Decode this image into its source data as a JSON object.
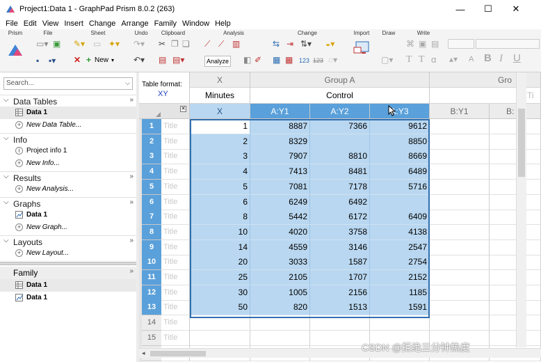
{
  "window": {
    "title": "Project1:Data 1 - GraphPad Prism 8.0.2 (263)",
    "minimize": "—",
    "maximize": "☐",
    "close": "✕"
  },
  "menu": [
    "File",
    "Edit",
    "View",
    "Insert",
    "Change",
    "Arrange",
    "Family",
    "Window",
    "Help"
  ],
  "ribbon": {
    "groups": [
      "Prism",
      "File",
      "Sheet",
      "Undo",
      "Clipboard",
      "Analysis",
      "Change",
      "Import",
      "Draw",
      "Write"
    ],
    "new_label": "New",
    "analyze_label": "Analyze"
  },
  "navigator": {
    "search_placeholder": "Search...",
    "sections": [
      {
        "label": "Data Tables",
        "items": [
          {
            "label": "Data 1",
            "selected": true
          },
          {
            "label": "New Data Table...",
            "new": true
          }
        ]
      },
      {
        "label": "Info",
        "items": [
          {
            "label": "Project info 1"
          },
          {
            "label": "New Info...",
            "new": true
          }
        ]
      },
      {
        "label": "Results",
        "items": [
          {
            "label": "New Analysis...",
            "new": true
          }
        ]
      },
      {
        "label": "Graphs",
        "items": [
          {
            "label": "Data 1"
          },
          {
            "label": "New Graph...",
            "new": true
          }
        ]
      },
      {
        "label": "Layouts",
        "items": [
          {
            "label": "New Layout...",
            "new": true
          }
        ]
      }
    ],
    "family": {
      "label": "Family",
      "items": [
        {
          "label": "Data 1"
        },
        {
          "label": "Data 1"
        }
      ]
    },
    "more_glyph": "»"
  },
  "sheet": {
    "table_format_label": "Table format:",
    "table_format_value": "XY",
    "x_group_label": "X",
    "x_title": "Minutes",
    "x_column": "X",
    "group_a_label": "Group A",
    "group_a_title": "Control",
    "group_b_label": "Gro",
    "group_b_title": "Ti",
    "columns": [
      "A:Y1",
      "A:Y2",
      "A:Y3",
      "B:Y1",
      "B:"
    ],
    "row_title_placeholder": "Title",
    "rows": [
      {
        "n": "1",
        "x": "1",
        "y1": "8887",
        "y2": "7366",
        "y3": "9612"
      },
      {
        "n": "2",
        "x": "2",
        "y1": "8329",
        "y2": "",
        "y3": "8850"
      },
      {
        "n": "3",
        "x": "3",
        "y1": "7907",
        "y2": "8810",
        "y3": "8669"
      },
      {
        "n": "4",
        "x": "4",
        "y1": "7413",
        "y2": "8481",
        "y3": "6489"
      },
      {
        "n": "5",
        "x": "5",
        "y1": "7081",
        "y2": "7178",
        "y3": "5716"
      },
      {
        "n": "6",
        "x": "6",
        "y1": "6249",
        "y2": "6492",
        "y3": ""
      },
      {
        "n": "7",
        "x": "8",
        "y1": "5442",
        "y2": "6172",
        "y3": "6409"
      },
      {
        "n": "8",
        "x": "10",
        "y1": "4020",
        "y2": "3758",
        "y3": "4138"
      },
      {
        "n": "9",
        "x": "14",
        "y1": "4559",
        "y2": "3146",
        "y3": "2547"
      },
      {
        "n": "10",
        "x": "20",
        "y1": "3033",
        "y2": "1587",
        "y3": "2754"
      },
      {
        "n": "11",
        "x": "25",
        "y1": "2105",
        "y2": "1707",
        "y3": "2152"
      },
      {
        "n": "12",
        "x": "30",
        "y1": "1005",
        "y2": "2156",
        "y3": "1185"
      },
      {
        "n": "13",
        "x": "50",
        "y1": "820",
        "y2": "1513",
        "y3": "1591"
      },
      {
        "n": "14",
        "x": "",
        "y1": "",
        "y2": "",
        "y3": ""
      },
      {
        "n": "15",
        "x": "",
        "y1": "",
        "y2": "",
        "y3": ""
      },
      {
        "n": "16",
        "x": "",
        "y1": "",
        "y2": "",
        "y3": ""
      }
    ],
    "selected_rows": 13
  },
  "watermark": "CSDN @拒绝三分钟热度",
  "colors": {
    "selection_fill": "#b9d7f0",
    "selection_border": "#2f6fb0",
    "row_header_selected": "#5aa0da",
    "table_format_value": "#1f3fbf"
  }
}
